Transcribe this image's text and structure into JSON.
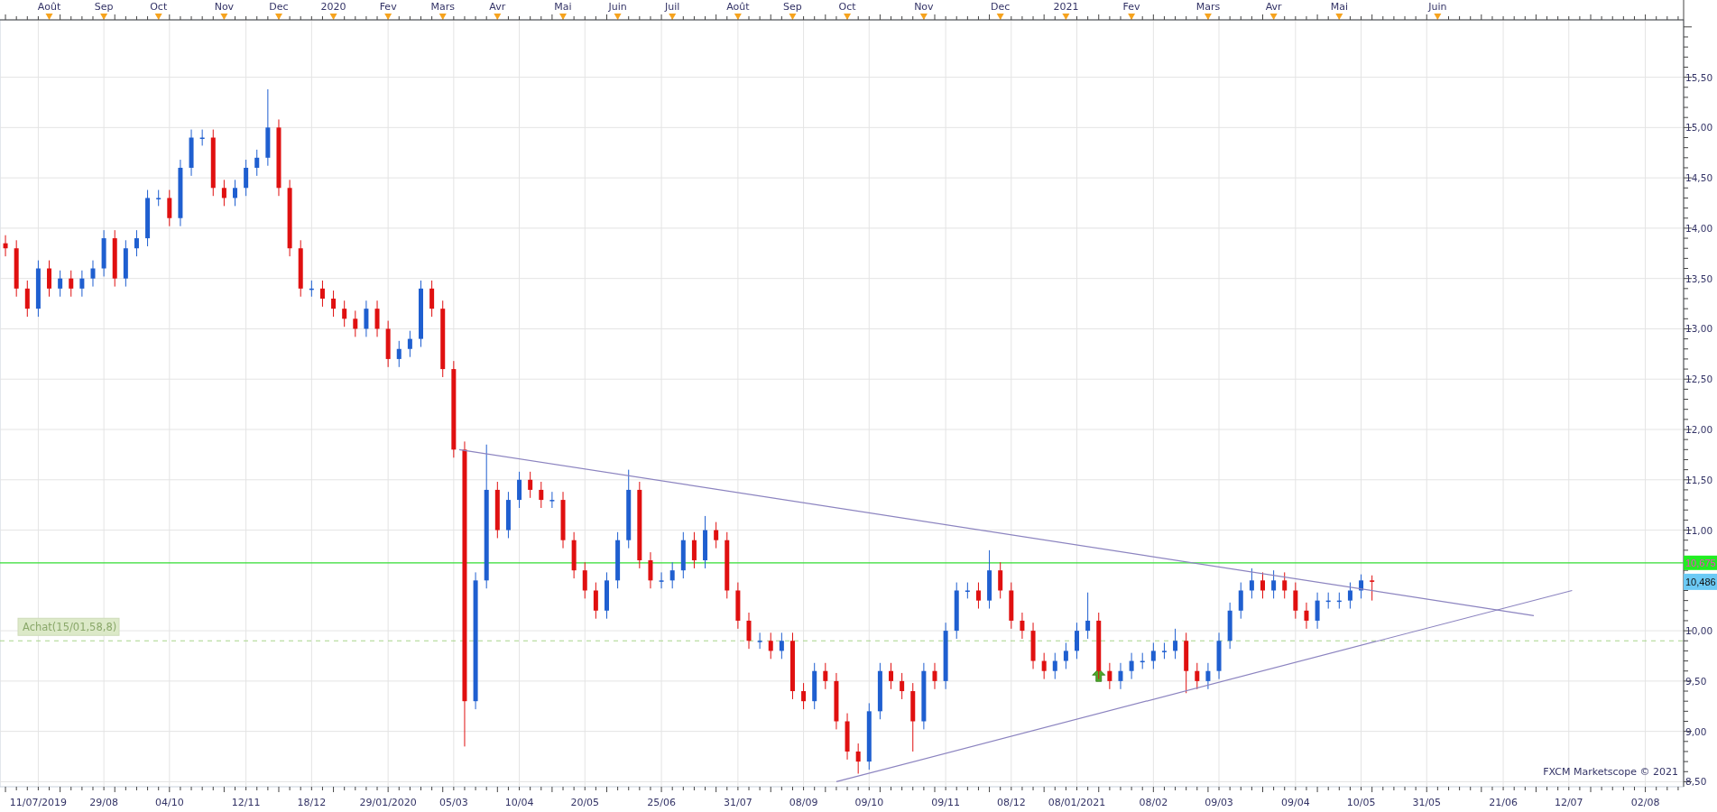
{
  "top_axis": [
    "Août",
    "Sep",
    "Oct",
    "Nov",
    "Dec",
    "2020",
    "Fev",
    "Mars",
    "Avr",
    "Mai",
    "Juin",
    "Juil",
    "Août",
    "Sep",
    "Oct",
    "Nov",
    "Dec",
    "2021",
    "Fev",
    "Mars",
    "Avr",
    "Mai",
    "Juin"
  ],
  "chart_data": {
    "type": "candlestick",
    "grid": true,
    "ylim": [
      8.45,
      16.07
    ],
    "categories": [
      null,
      null,
      null,
      "11/07/2019",
      null,
      null,
      null,
      null,
      null,
      "29/08",
      null,
      null,
      null,
      null,
      null,
      "04/10",
      null,
      null,
      null,
      null,
      null,
      null,
      "12/11",
      null,
      null,
      null,
      null,
      null,
      "18/12",
      null,
      null,
      null,
      null,
      null,
      null,
      "29/01/2020",
      null,
      null,
      null,
      null,
      null,
      "05/03",
      null,
      null,
      null,
      null,
      null,
      "10/04",
      null,
      null,
      null,
      null,
      null,
      "20/05",
      null,
      null,
      null,
      null,
      null,
      null,
      "25/06",
      null,
      null,
      null,
      null,
      null,
      null,
      "31/07",
      null,
      null,
      null,
      null,
      null,
      "08/09",
      null,
      null,
      null,
      null,
      null,
      "09/10",
      null,
      null,
      null,
      null,
      null,
      null,
      "09/11",
      null,
      null,
      null,
      null,
      null,
      "08/12",
      null,
      null,
      null,
      null,
      null,
      "08/01/2021",
      null,
      null,
      null,
      null,
      null,
      null,
      "08/02",
      null,
      null,
      null,
      null,
      null,
      "09/03",
      null,
      null,
      null,
      null,
      null,
      null,
      "09/04",
      null,
      null,
      null,
      null,
      null,
      "10/05",
      null,
      null,
      null,
      null,
      null,
      "31/05",
      null,
      null,
      null,
      null,
      null,
      null,
      "21/06",
      null,
      null,
      null,
      null,
      null,
      "12/07",
      null,
      null,
      null,
      null,
      null,
      null,
      "02/08",
      null,
      null,
      null
    ],
    "ohlc": [
      [
        13.85,
        13.93,
        13.72,
        13.8
      ],
      [
        13.8,
        13.88,
        13.32,
        13.4
      ],
      [
        13.4,
        13.48,
        13.12,
        13.2
      ],
      [
        13.2,
        13.68,
        13.12,
        13.6
      ],
      [
        13.6,
        13.68,
        13.32,
        13.4
      ],
      [
        13.4,
        13.58,
        13.32,
        13.5
      ],
      [
        13.5,
        13.58,
        13.32,
        13.4
      ],
      [
        13.4,
        13.58,
        13.32,
        13.5
      ],
      [
        13.5,
        13.68,
        13.42,
        13.6
      ],
      [
        13.6,
        13.98,
        13.52,
        13.9
      ],
      [
        13.9,
        13.98,
        13.42,
        13.5
      ],
      [
        13.5,
        13.88,
        13.42,
        13.8
      ],
      [
        13.8,
        13.98,
        13.72,
        13.9
      ],
      [
        13.9,
        14.38,
        13.82,
        14.3
      ],
      [
        14.3,
        14.38,
        14.22,
        14.3
      ],
      [
        14.3,
        14.38,
        14.02,
        14.1
      ],
      [
        14.1,
        14.68,
        14.02,
        14.6
      ],
      [
        14.6,
        14.98,
        14.52,
        14.9
      ],
      [
        14.9,
        14.98,
        14.82,
        14.9
      ],
      [
        14.9,
        14.98,
        14.32,
        14.4
      ],
      [
        14.4,
        14.48,
        14.22,
        14.3
      ],
      [
        14.3,
        14.48,
        14.22,
        14.4
      ],
      [
        14.4,
        14.68,
        14.32,
        14.6
      ],
      [
        14.6,
        14.78,
        14.52,
        14.7
      ],
      [
        14.7,
        15.38,
        14.62,
        15.0
      ],
      [
        15.0,
        15.08,
        14.32,
        14.4
      ],
      [
        14.4,
        14.48,
        13.72,
        13.8
      ],
      [
        13.8,
        13.88,
        13.32,
        13.4
      ],
      [
        13.4,
        13.48,
        13.32,
        13.4
      ],
      [
        13.4,
        13.48,
        13.22,
        13.3
      ],
      [
        13.3,
        13.38,
        13.12,
        13.2
      ],
      [
        13.2,
        13.28,
        13.02,
        13.1
      ],
      [
        13.1,
        13.18,
        12.92,
        13.0
      ],
      [
        13.0,
        13.28,
        12.92,
        13.2
      ],
      [
        13.2,
        13.28,
        12.92,
        13.0
      ],
      [
        13.0,
        13.08,
        12.62,
        12.7
      ],
      [
        12.7,
        12.88,
        12.62,
        12.8
      ],
      [
        12.8,
        12.98,
        12.72,
        12.9
      ],
      [
        12.9,
        13.48,
        12.82,
        13.4
      ],
      [
        13.4,
        13.48,
        13.12,
        13.2
      ],
      [
        13.2,
        13.28,
        12.52,
        12.6
      ],
      [
        12.6,
        12.68,
        11.72,
        11.8
      ],
      [
        11.8,
        11.88,
        8.85,
        9.3
      ],
      [
        9.3,
        10.58,
        9.22,
        10.5
      ],
      [
        10.5,
        11.85,
        10.42,
        11.4
      ],
      [
        11.4,
        11.48,
        10.92,
        11.0
      ],
      [
        11.0,
        11.38,
        10.92,
        11.3
      ],
      [
        11.3,
        11.58,
        11.22,
        11.5
      ],
      [
        11.5,
        11.58,
        11.32,
        11.4
      ],
      [
        11.4,
        11.48,
        11.22,
        11.3
      ],
      [
        11.3,
        11.38,
        11.22,
        11.3
      ],
      [
        11.3,
        11.38,
        10.82,
        10.9
      ],
      [
        10.9,
        10.98,
        10.52,
        10.6
      ],
      [
        10.6,
        10.68,
        10.32,
        10.4
      ],
      [
        10.4,
        10.48,
        10.12,
        10.2
      ],
      [
        10.2,
        10.58,
        10.12,
        10.5
      ],
      [
        10.5,
        10.98,
        10.42,
        10.9
      ],
      [
        10.9,
        11.6,
        10.82,
        11.4
      ],
      [
        11.4,
        11.48,
        10.62,
        10.7
      ],
      [
        10.7,
        10.78,
        10.42,
        10.5
      ],
      [
        10.5,
        10.58,
        10.42,
        10.5
      ],
      [
        10.5,
        10.68,
        10.42,
        10.6
      ],
      [
        10.6,
        10.98,
        10.52,
        10.9
      ],
      [
        10.9,
        10.98,
        10.62,
        10.7
      ],
      [
        10.7,
        11.14,
        10.62,
        11.0
      ],
      [
        11.0,
        11.08,
        10.82,
        10.9
      ],
      [
        10.9,
        10.98,
        10.32,
        10.4
      ],
      [
        10.4,
        10.48,
        10.02,
        10.1
      ],
      [
        10.1,
        10.18,
        9.82,
        9.9
      ],
      [
        9.9,
        9.98,
        9.82,
        9.9
      ],
      [
        9.9,
        9.98,
        9.72,
        9.8
      ],
      [
        9.8,
        9.98,
        9.72,
        9.9
      ],
      [
        9.9,
        9.98,
        9.32,
        9.4
      ],
      [
        9.4,
        9.48,
        9.22,
        9.3
      ],
      [
        9.3,
        9.68,
        9.22,
        9.6
      ],
      [
        9.6,
        9.68,
        9.42,
        9.5
      ],
      [
        9.5,
        9.58,
        9.02,
        9.1
      ],
      [
        9.1,
        9.18,
        8.72,
        8.8
      ],
      [
        8.8,
        8.88,
        8.58,
        8.7
      ],
      [
        8.7,
        9.28,
        8.62,
        9.2
      ],
      [
        9.2,
        9.68,
        9.12,
        9.6
      ],
      [
        9.6,
        9.68,
        9.42,
        9.5
      ],
      [
        9.5,
        9.58,
        9.32,
        9.4
      ],
      [
        9.4,
        9.48,
        8.8,
        9.1
      ],
      [
        9.1,
        9.68,
        9.02,
        9.6
      ],
      [
        9.6,
        9.68,
        9.42,
        9.5
      ],
      [
        9.5,
        10.08,
        9.42,
        10.0
      ],
      [
        10.0,
        10.48,
        9.92,
        10.4
      ],
      [
        10.4,
        10.48,
        10.32,
        10.4
      ],
      [
        10.4,
        10.48,
        10.22,
        10.3
      ],
      [
        10.3,
        10.8,
        10.22,
        10.6
      ],
      [
        10.6,
        10.68,
        10.32,
        10.4
      ],
      [
        10.4,
        10.48,
        10.02,
        10.1
      ],
      [
        10.1,
        10.18,
        9.92,
        10.0
      ],
      [
        10.0,
        10.08,
        9.62,
        9.7
      ],
      [
        9.7,
        9.78,
        9.52,
        9.6
      ],
      [
        9.6,
        9.78,
        9.52,
        9.7
      ],
      [
        9.7,
        9.88,
        9.62,
        9.8
      ],
      [
        9.8,
        10.08,
        9.72,
        10.0
      ],
      [
        10.0,
        10.38,
        9.92,
        10.1
      ],
      [
        10.1,
        10.18,
        9.52,
        9.6
      ],
      [
        9.6,
        9.68,
        9.42,
        9.5
      ],
      [
        9.5,
        9.68,
        9.42,
        9.6
      ],
      [
        9.6,
        9.78,
        9.52,
        9.7
      ],
      [
        9.7,
        9.78,
        9.62,
        9.7
      ],
      [
        9.7,
        9.88,
        9.62,
        9.8
      ],
      [
        9.8,
        9.88,
        9.72,
        9.8
      ],
      [
        9.8,
        10.02,
        9.72,
        9.9
      ],
      [
        9.9,
        9.98,
        9.38,
        9.6
      ],
      [
        9.6,
        9.68,
        9.42,
        9.5
      ],
      [
        9.5,
        9.68,
        9.42,
        9.6
      ],
      [
        9.6,
        9.98,
        9.52,
        9.9
      ],
      [
        9.9,
        10.28,
        9.82,
        10.2
      ],
      [
        10.2,
        10.48,
        10.12,
        10.4
      ],
      [
        10.4,
        10.62,
        10.32,
        10.5
      ],
      [
        10.5,
        10.58,
        10.32,
        10.4
      ],
      [
        10.4,
        10.6,
        10.32,
        10.5
      ],
      [
        10.5,
        10.58,
        10.32,
        10.4
      ],
      [
        10.4,
        10.48,
        10.12,
        10.2
      ],
      [
        10.2,
        10.28,
        10.02,
        10.1
      ],
      [
        10.1,
        10.38,
        10.02,
        10.3
      ],
      [
        10.3,
        10.38,
        10.22,
        10.3
      ],
      [
        10.3,
        10.38,
        10.22,
        10.3
      ],
      [
        10.3,
        10.48,
        10.22,
        10.4
      ],
      [
        10.4,
        10.56,
        10.32,
        10.5
      ],
      [
        10.5,
        10.55,
        10.3,
        10.486
      ],
      null,
      null,
      null,
      null,
      null,
      null,
      null,
      null,
      null,
      null,
      null,
      null,
      null,
      null,
      null,
      null,
      null,
      null,
      null,
      null,
      null,
      null,
      null,
      null,
      null,
      null,
      null,
      null
    ],
    "yticks": [
      {
        "value": 8.5,
        "label": "8,50"
      },
      {
        "value": 9,
        "label": "9,00"
      },
      {
        "value": 9.5,
        "label": "9,50"
      },
      {
        "value": 10,
        "label": "10,00"
      },
      {
        "value": 11,
        "label": "11,00"
      },
      {
        "value": 11.5,
        "label": "11,50"
      },
      {
        "value": 12,
        "label": "12,00"
      },
      {
        "value": 12.5,
        "label": "12,50"
      },
      {
        "value": 13,
        "label": "13,00"
      },
      {
        "value": 13.5,
        "label": "13,50"
      },
      {
        "value": 14,
        "label": "14,00"
      },
      {
        "value": 14.5,
        "label": "14,50"
      },
      {
        "value": 15,
        "label": "15,00"
      },
      {
        "value": 15.5,
        "label": "15,50"
      }
    ],
    "ref_lines": [
      {
        "axis": "y",
        "value": 10.675,
        "label": "10,675"
      },
      {
        "axis": "y",
        "value": 9.9
      }
    ],
    "annotations": [
      "Achat(15/01,58,8)",
      {
        "text": "10,486",
        "y": 10.486
      }
    ]
  },
  "credit": "FXCM Marketscope © 2021"
}
